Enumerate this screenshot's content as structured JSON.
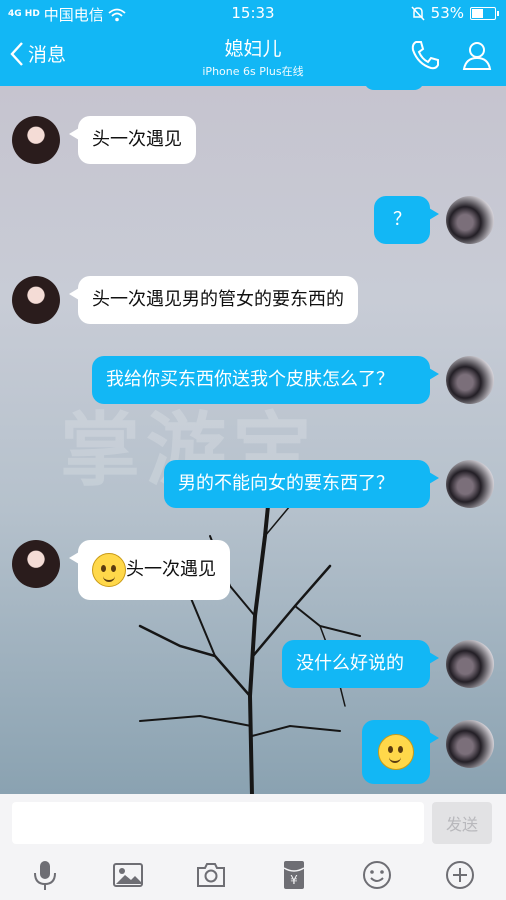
{
  "status_bar": {
    "signal": "4G HD",
    "carrier": "中国电信",
    "time": "15:33",
    "battery": "53%",
    "battery_level": 0.53
  },
  "header": {
    "back_label": "消息",
    "title": "媳妇儿",
    "subtitle": "iPhone 6s Plus在线",
    "bg_color": "#12b7f5"
  },
  "watermark": "掌游宝",
  "messages": [
    {
      "from": "her",
      "text": "头一次遇见"
    },
    {
      "from": "me",
      "text": "？"
    },
    {
      "from": "her",
      "text": "头一次遇见男的管女的要东西的"
    },
    {
      "from": "me",
      "text": "我给你买东西你送我个皮肤怎么了？"
    },
    {
      "from": "me",
      "text": "男的不能向女的要东西了？"
    },
    {
      "from": "her",
      "emoji": "sweat-smile-emoji",
      "text": "头一次遇见"
    },
    {
      "from": "me",
      "text": "没什么好说的"
    },
    {
      "from": "me",
      "emoji": "smile-emoji",
      "text": ""
    }
  ],
  "input": {
    "placeholder": "",
    "value": "",
    "send_label": "发送"
  },
  "toolbar": {
    "icons": [
      "microphone-icon",
      "image-icon",
      "camera-icon",
      "red-packet-icon",
      "emoji-icon",
      "plus-icon"
    ],
    "red_packet_label": "¥"
  },
  "colors": {
    "accent": "#12b7f5",
    "bubble_in": "#ffffff"
  }
}
